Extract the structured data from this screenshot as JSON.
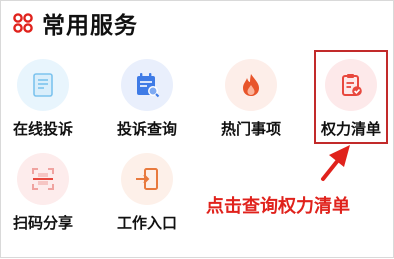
{
  "header": {
    "title": "常用服务",
    "icon": "grid-icon"
  },
  "services": [
    {
      "label": "在线投诉",
      "icon": "document-icon",
      "color": "#3aa8e8",
      "bg": "#e8f5fd"
    },
    {
      "label": "投诉查询",
      "icon": "calendar-search-icon",
      "color": "#3f7be6",
      "bg": "#e9effc"
    },
    {
      "label": "热门事项",
      "icon": "flame-icon",
      "color": "#e8552b",
      "bg": "#fdeee9"
    },
    {
      "label": "权力清单",
      "icon": "clipboard-check-icon",
      "color": "#e8483e",
      "bg": "#fde9ea"
    },
    {
      "label": "扫码分享",
      "icon": "qr-scan-icon",
      "color": "#e8483e",
      "bg": "#fdecec"
    },
    {
      "label": "工作入口",
      "icon": "door-enter-icon",
      "color": "#e87a3e",
      "bg": "#fdf0e9"
    }
  ],
  "annotation": {
    "text": "点击查询权力清单",
    "color": "#e0221c"
  }
}
